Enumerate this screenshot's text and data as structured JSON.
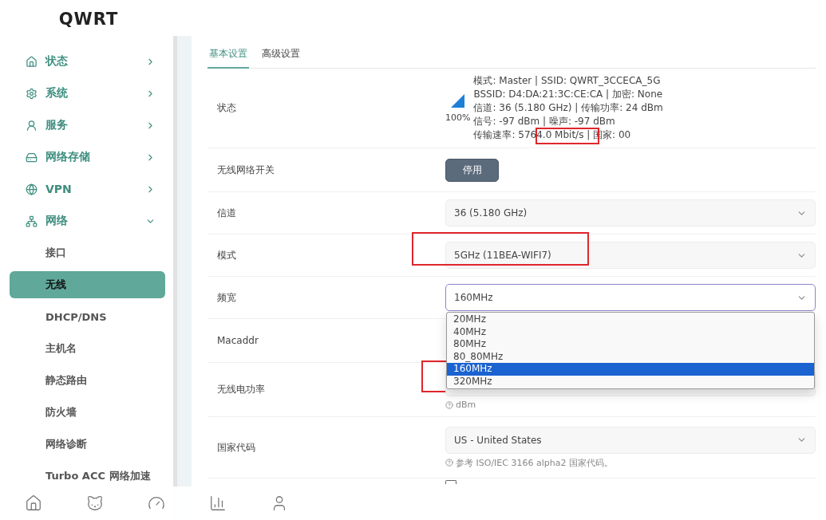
{
  "app": {
    "title": "QWRT"
  },
  "sidebar": {
    "items": [
      {
        "label": "状态",
        "expanded": false
      },
      {
        "label": "系统",
        "expanded": false
      },
      {
        "label": "服务",
        "expanded": false
      },
      {
        "label": "网络存储",
        "expanded": false
      },
      {
        "label": "VPN",
        "expanded": false
      },
      {
        "label": "网络",
        "expanded": true,
        "children": [
          {
            "label": "接口",
            "selected": false
          },
          {
            "label": "无线",
            "selected": true
          },
          {
            "label": "DHCP/DNS",
            "selected": false
          },
          {
            "label": "主机名",
            "selected": false
          },
          {
            "label": "静态路由",
            "selected": false
          },
          {
            "label": "防火墙",
            "selected": false
          },
          {
            "label": "网络诊断",
            "selected": false
          },
          {
            "label": "Turbo ACC 网络加速",
            "selected": false
          }
        ]
      }
    ]
  },
  "tabs": [
    {
      "label": "基本设置",
      "selected": true
    },
    {
      "label": "高级设置",
      "selected": false
    }
  ],
  "rows": [
    {
      "kind": "status",
      "label": "状态",
      "signal": "100%",
      "lines": [
        {
          "text": "模式: Master | SSID: QWRT_3CCECA_5G",
          "highlighted": false
        },
        {
          "text": "BSSID: D4:DA:21:3C:CE:CA | 加密: None",
          "highlighted": false
        },
        {
          "text": "信道: 36 (5.180 GHz) | 传输功率: 24 dBm",
          "highlighted": false
        },
        {
          "text": "信号: -97 dBm | 噪声: -97 dBm",
          "highlighted": false
        },
        {
          "text": "传输速率: 5764.0 Mbit/s | 国家: 00",
          "highlighted": true
        }
      ]
    },
    {
      "kind": "button",
      "label": "无线网络开关",
      "button": "停用"
    },
    {
      "kind": "select",
      "label": "信道",
      "value": "36 (5.180 GHz)",
      "highlighted": false,
      "open": false
    },
    {
      "kind": "select",
      "label": "模式",
      "value": "5GHz (11BEA-WIFI7)",
      "highlighted": true,
      "open": false
    },
    {
      "kind": "select",
      "label": "频宽",
      "value": "160MHz",
      "highlighted": false,
      "open": true,
      "options": [
        {
          "label": "20MHz",
          "selected": false
        },
        {
          "label": "40MHz",
          "selected": false
        },
        {
          "label": "80MHz",
          "selected": false
        },
        {
          "label": "80_80MHz",
          "selected": false
        },
        {
          "label": "160MHz",
          "selected": true,
          "highlighted": true
        },
        {
          "label": "320MHz",
          "selected": false
        }
      ]
    },
    {
      "kind": "covered",
      "label": "Macaddr"
    },
    {
      "kind": "covered-select",
      "label": "无线电功率",
      "hint": "dBm"
    },
    {
      "kind": "select",
      "label": "国家代码",
      "value": "US - United States",
      "highlighted": false,
      "open": false,
      "hint": "参考 ISO/IEC 3166 alpha2 国家代码。"
    },
    {
      "kind": "checkbox",
      "checked": false
    }
  ]
}
